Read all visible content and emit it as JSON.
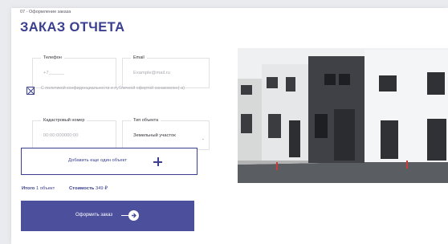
{
  "breadcrumb": "07 - Оформление заказа",
  "title": "ЗАКАЗ ОТЧЕТА",
  "fields": {
    "phone": {
      "label": "Телефон",
      "value": "+7______"
    },
    "email": {
      "label": "Email",
      "placeholder": "Example@mail.ru"
    },
    "cadastral": {
      "label": "Кадастровый номер",
      "placeholder": "00:00:000000:00"
    },
    "object_type": {
      "label": "Тип объекта",
      "value": "Земельный участок"
    }
  },
  "consent": {
    "checked": true,
    "text": "С политикой конфиденциальности и публичной офертой ознакомлен(-а)"
  },
  "add_object_button": "Добавить еще один объект",
  "summary": {
    "total_label": "Итого",
    "total_value": "1 объект",
    "cost_label": "Стоимость",
    "cost_value": "349 ₽"
  },
  "order_button": "Оформить заказ",
  "photo": {
    "subject": "modern townhouses"
  },
  "colors": {
    "accent": "#3a3f8f",
    "button": "#4b4f9c",
    "background": "#e9ebef"
  }
}
